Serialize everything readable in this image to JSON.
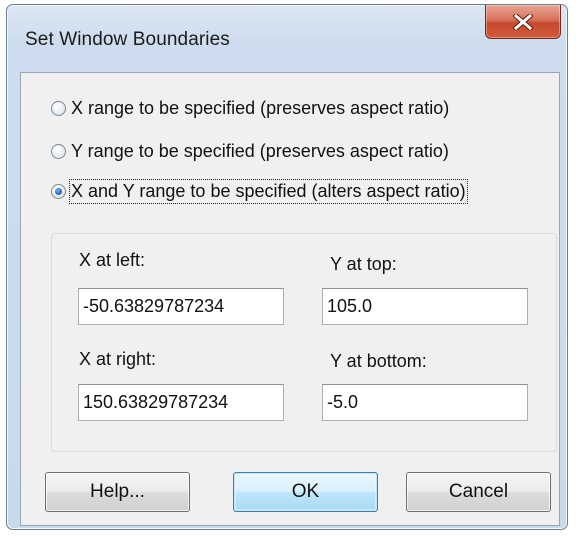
{
  "window": {
    "title": "Set Window Boundaries"
  },
  "radio_options": [
    {
      "label": "X range to be specified (preserves aspect ratio)",
      "checked": false
    },
    {
      "label": "Y range to be specified (preserves aspect ratio)",
      "checked": false
    },
    {
      "label": "X and Y range to be specified (alters aspect ratio)",
      "checked": true
    }
  ],
  "fields": {
    "x_left": {
      "label": "X at left:",
      "value": "-50.63829787234"
    },
    "y_top": {
      "label": "Y at top:",
      "value": "105.0"
    },
    "x_right": {
      "label": "X at right:",
      "value": "150.63829787234"
    },
    "y_bottom": {
      "label": "Y at bottom:",
      "value": "-5.0"
    }
  },
  "buttons": {
    "help": "Help...",
    "ok": "OK",
    "cancel": "Cancel"
  },
  "icons": {
    "close": "close-icon",
    "radio": "radio-button"
  },
  "colors": {
    "close_button": "#d25a3a",
    "default_button_border": "#3c7fb1",
    "title_bar": "#dce7f3"
  }
}
